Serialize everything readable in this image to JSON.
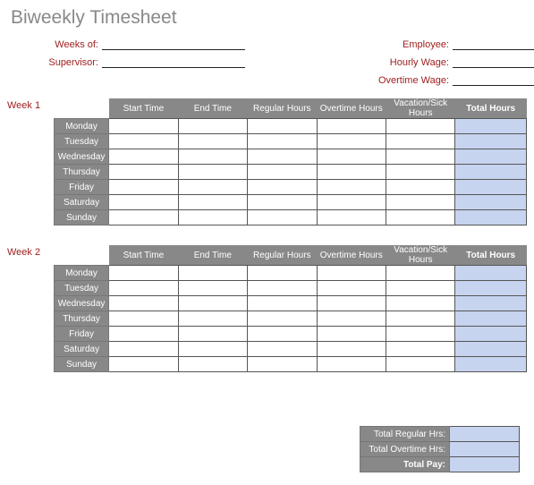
{
  "title": "Biweekly Timesheet",
  "fields": {
    "weeks_of": "Weeks of:",
    "supervisor": "Supervisor:",
    "employee": "Employee:",
    "hourly_wage": "Hourly Wage:",
    "overtime_wage": "Overtime Wage:"
  },
  "weeks": [
    {
      "label": "Week 1"
    },
    {
      "label": "Week 2"
    }
  ],
  "columns": {
    "start_time": "Start Time",
    "end_time": "End Time",
    "regular_hours": "Regular Hours",
    "overtime_hours": "Overtime Hours",
    "vacation_sick": "Vacation/Sick Hours",
    "total_hours": "Total Hours"
  },
  "days": [
    "Monday",
    "Tuesday",
    "Wednesday",
    "Thursday",
    "Friday",
    "Saturday",
    "Sunday"
  ],
  "totals": {
    "regular": "Total Regular Hrs:",
    "overtime": "Total Overtime Hrs:",
    "pay": "Total Pay:"
  }
}
